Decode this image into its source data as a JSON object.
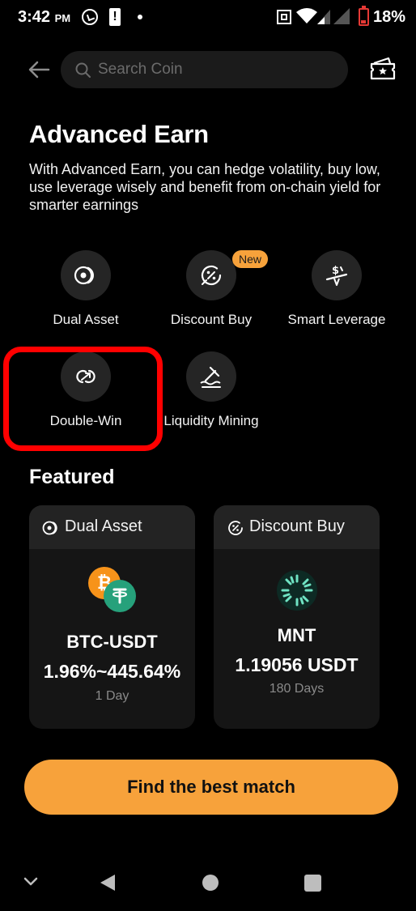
{
  "status_bar": {
    "time": "3:42",
    "ampm": "PM",
    "battery": "18%"
  },
  "header": {
    "search_placeholder": "Search Coin"
  },
  "page": {
    "title": "Advanced Earn",
    "description": "With Advanced Earn, you can hedge volatility, buy low, use leverage wisely and benefit from on-chain yield for smarter earnings"
  },
  "features": [
    {
      "label": "Dual Asset",
      "icon": "dual-asset-icon"
    },
    {
      "label": "Discount Buy",
      "icon": "discount-buy-icon",
      "badge": "New"
    },
    {
      "label": "Smart Leverage",
      "icon": "smart-leverage-icon"
    },
    {
      "label": "Double-Win",
      "icon": "double-win-icon"
    },
    {
      "label": "Liquidity Mining",
      "icon": "liquidity-mining-icon"
    }
  ],
  "featured": {
    "heading": "Featured",
    "cards": [
      {
        "type": "Dual Asset",
        "pair": "BTC-USDT",
        "value": "1.96%~445.64%",
        "duration": "1 Day"
      },
      {
        "type": "Discount Buy",
        "pair": "MNT",
        "value": "1.19056 USDT",
        "duration": "180 Days"
      }
    ]
  },
  "cta": {
    "label": "Find the best match"
  },
  "colors": {
    "accent": "#f7a23b",
    "highlight": "#ff0000",
    "background": "#000000",
    "card": "#151515"
  }
}
